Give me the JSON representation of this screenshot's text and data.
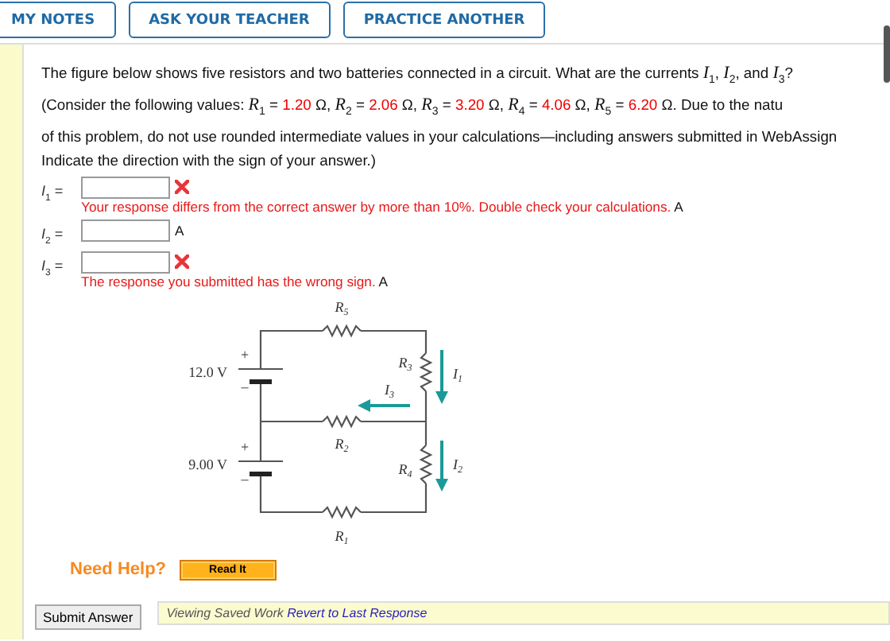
{
  "toolbar": {
    "buttons": [
      "MY NOTES",
      "ASK YOUR TEACHER",
      "PRACTICE ANOTHER"
    ]
  },
  "question": {
    "intro": "The figure below shows five resistors and two batteries connected in a circuit. What are the currents *I*$_{1}$, *I*$_{2}$, and *I*$_{3}$?",
    "values_prefix": "(Consider the following values:",
    "values": [
      {
        "symbol": "*R*$_{1}$ =",
        "value": "1.20",
        "unit": "Ω,"
      },
      {
        "symbol": "*R*$_{2}$ =",
        "value": "2.06",
        "unit": "Ω,"
      },
      {
        "symbol": "*R*$_{3}$ =",
        "value": "3.20",
        "unit": "Ω,"
      },
      {
        "symbol": "*R*$_{4}$ =",
        "value": "4.06",
        "unit": "Ω,"
      },
      {
        "symbol": "*R*$_{5}$ =",
        "value": "6.20",
        "unit": "Ω."
      }
    ],
    "values_suffix": "Due to the natu",
    "lines": [
      "of this problem, do not use rounded intermediate values in your calculations—including answers submitted in WebAssign",
      "Indicate the direction with the sign of your answer.)"
    ]
  },
  "answers": [
    {
      "label": "*I*$_{1}$ =",
      "unit": "A",
      "wrong": true,
      "feedback": "Your response differs from the correct answer by more than 10%. Double check your calculations."
    },
    {
      "label": "*I*$_{2}$ =",
      "unit": "A",
      "wrong": false
    },
    {
      "label": "*I*$_{3}$ =",
      "unit": "A",
      "wrong": true,
      "feedback": "The response you submitted has the wrong sign."
    }
  ],
  "figure": {
    "labels": [
      "R$_{5}$",
      "R$_{3}$",
      "I$_{1}$",
      "I$_{3}$",
      "12.0 V",
      "+",
      "–",
      "R$_{2}$",
      "9.00 V",
      "+",
      "–",
      "R$_{4}$",
      "I$_{2}$",
      "R$_{1}$"
    ]
  },
  "help": {
    "label": "Need Help?",
    "button": "Read It"
  },
  "footer": {
    "submit": "Submit Answer",
    "status": "Viewing Saved Work",
    "link": "Revert to Last Response"
  }
}
